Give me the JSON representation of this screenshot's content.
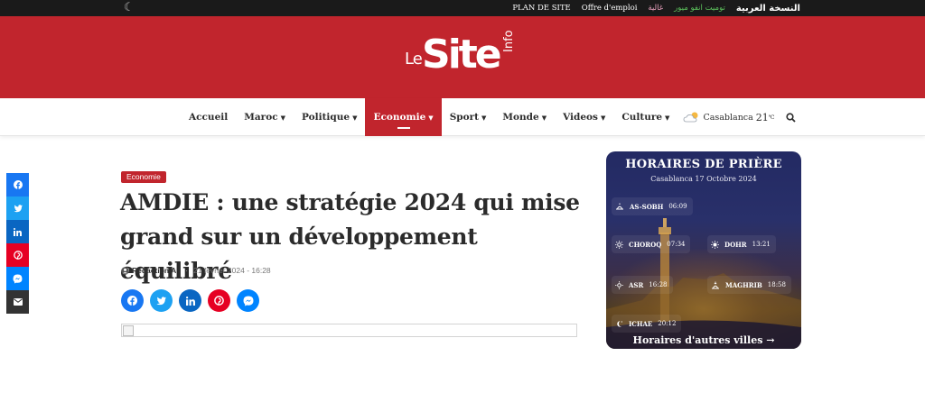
{
  "topbar": {
    "arabic_edition": "النسخة العربية",
    "link_green": "توميت انفو ميور",
    "link_pink": "غالية",
    "job_offers": "Offre d'emploi",
    "sitemap": "PLAN DE SITE"
  },
  "logo": {
    "le": "Le",
    "site": "Site",
    "info": "Info"
  },
  "nav": {
    "items": [
      {
        "label": "Accueil",
        "caret": ""
      },
      {
        "label": "Maroc",
        "caret": "▼"
      },
      {
        "label": "Politique",
        "caret": "▼"
      },
      {
        "label": "Economie",
        "caret": "▼"
      },
      {
        "label": "Sport",
        "caret": "▼"
      },
      {
        "label": "Monde",
        "caret": "▼"
      },
      {
        "label": "Videos",
        "caret": "▼"
      },
      {
        "label": "Culture",
        "caret": "▼"
      }
    ],
    "weather_city": "Casablanca",
    "weather_temp": "21",
    "weather_unit": "℃"
  },
  "article": {
    "category": "Economie",
    "headline": "AMDIE : une stratégie 2024 qui mise grand sur un développement équilibré",
    "author": "Rédaction A",
    "date": "21 février 2024 - 16:28"
  },
  "prayer": {
    "title": "HORAIRES DE PRIÈRE",
    "date": "Casablanca 17 Octobre 2024",
    "times": [
      {
        "name": "AS-SOBH",
        "time": "06:09"
      },
      {
        "name": "CHOROQ",
        "time": "07:34"
      },
      {
        "name": "DOHR",
        "time": "13:21"
      },
      {
        "name": "ASR",
        "time": "16:28"
      },
      {
        "name": "MAGHRIB",
        "time": "18:58"
      },
      {
        "name": "ICHAE",
        "time": "20:12"
      }
    ],
    "more": "Horaires d'autres villes →"
  },
  "colors": {
    "brand_red": "#c1252d",
    "facebook": "#1877f2",
    "twitter": "#1da1f2",
    "linkedin": "#0a66c2",
    "pinterest": "#e60023",
    "messenger": "#0084ff",
    "email": "#333333"
  }
}
